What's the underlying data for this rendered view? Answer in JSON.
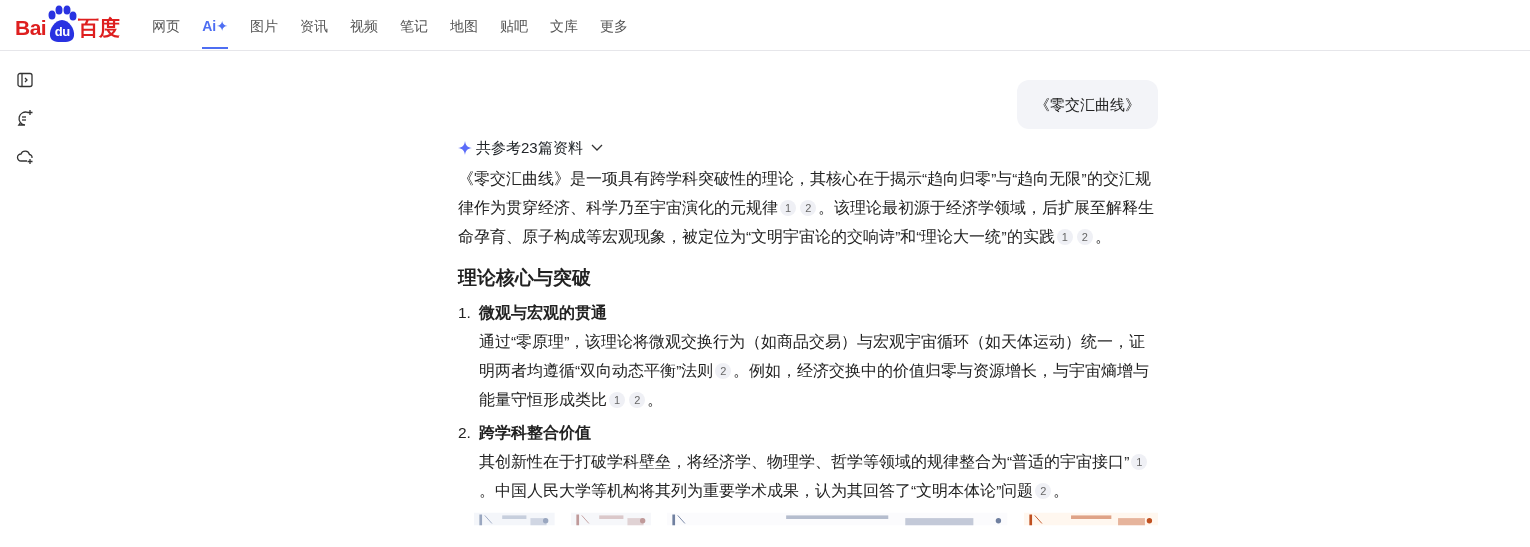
{
  "logo": {
    "left": "Bai",
    "paw": "du",
    "right": "百度"
  },
  "tabs": [
    {
      "label": "网页",
      "selected": false
    },
    {
      "label": "Ai✦",
      "selected": true
    },
    {
      "label": "图片",
      "selected": false
    },
    {
      "label": "资讯",
      "selected": false
    },
    {
      "label": "视频",
      "selected": false
    },
    {
      "label": "笔记",
      "selected": false
    },
    {
      "label": "地图",
      "selected": false
    },
    {
      "label": "贴吧",
      "selected": false
    },
    {
      "label": "文库",
      "selected": false
    },
    {
      "label": "更多",
      "selected": false
    }
  ],
  "sidebar": {
    "items": [
      {
        "kind": "panel"
      },
      {
        "kind": "chat"
      },
      {
        "kind": "cloud"
      }
    ]
  },
  "query": "《零交汇曲线》",
  "references": {
    "label": "共参考23篇资料",
    "expanded": false
  },
  "intro": [
    {
      "kind": "text",
      "text": "《零交汇曲线》是一项具有跨学科突破性的理论，其核心在于揭示“趋向归零”与“趋向无限”的交汇规律作为贯穿经济、科学乃至宇宙演化的元规律"
    },
    {
      "kind": "cite",
      "text": "1"
    },
    {
      "kind": "cite",
      "text": "2"
    },
    {
      "kind": "text",
      "text": "。该理论最初源于经济学领域，后扩展至解释生命孕育、原子构成等宏观现象，被定位为“文明宇宙论的交响诗”和“理论大一统”的实践"
    },
    {
      "kind": "cite",
      "text": "1"
    },
    {
      "kind": "cite",
      "text": "2"
    },
    {
      "kind": "text",
      "text": "。"
    }
  ],
  "section": {
    "heading": "理论核心与突破",
    "items": [
      {
        "number": "1.",
        "title": "微观与宏观的贯通",
        "body": [
          {
            "kind": "text",
            "text": "通过“零原理”，该理论将微观交换行为（如商品交易）与宏观宇宙循环（如天体运动）统一，证明两者均遵循“双向动态平衡”法则"
          },
          {
            "kind": "cite",
            "text": "2"
          },
          {
            "kind": "text",
            "text": "。例如，经济交换中的价值归零与资源增长，与宇宙熵增与能量守恒形成类比"
          },
          {
            "kind": "cite",
            "text": "1"
          },
          {
            "kind": "cite",
            "text": "2"
          },
          {
            "kind": "text",
            "text": "。"
          }
        ]
      },
      {
        "number": "2.",
        "title": "跨学科整合价值",
        "body": [
          {
            "kind": "text",
            "text": "其创新性在于打破学科壁垒，将经济学、物理学、哲学等领域的规律整合为“普适的宇宙接口”"
          },
          {
            "kind": "cite",
            "text": "1"
          },
          {
            "kind": "text",
            "text": "。中国人民大学等机构将其列为重要学术成果，认为其回答了“文明本体论”问题"
          },
          {
            "kind": "cite",
            "text": "2"
          },
          {
            "kind": "text",
            "text": "。"
          }
        ]
      }
    ]
  }
}
